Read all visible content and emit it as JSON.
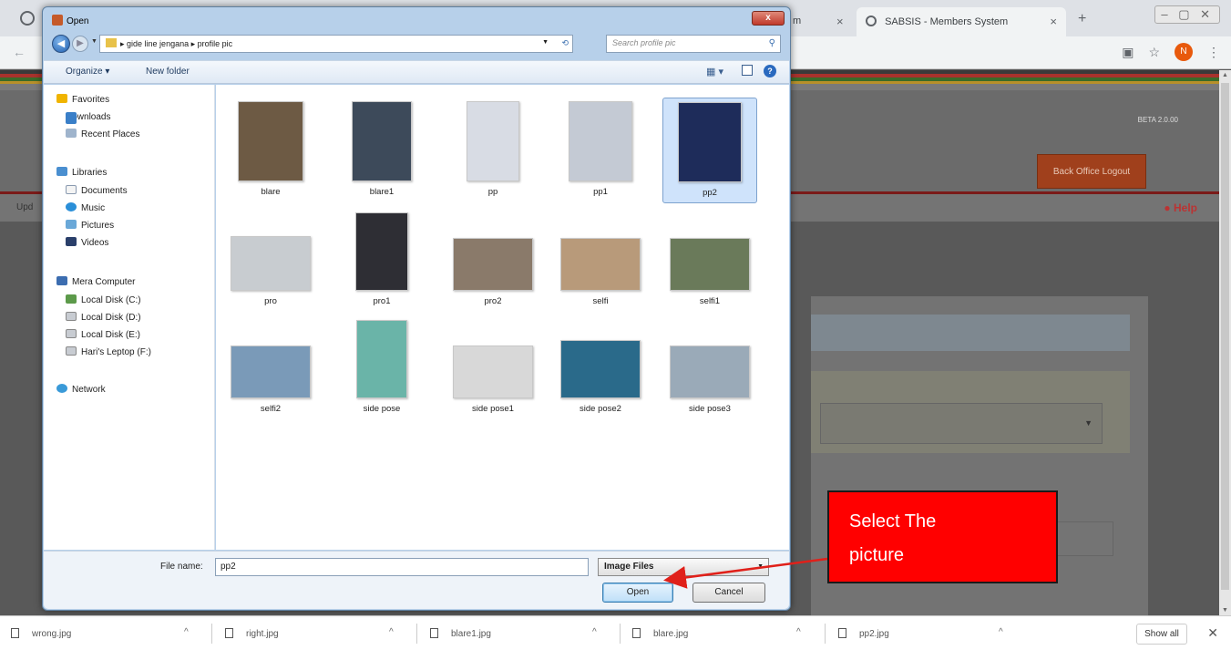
{
  "browser": {
    "tabs": [
      {
        "label": "m"
      },
      {
        "label": "SABSIS - Members System"
      }
    ],
    "profile_initial": "N",
    "version_text": "BETA 2.0.00",
    "back_office_label": "Back Office Logout",
    "nav_left_text": "Upd",
    "help_label": "Help"
  },
  "dialog": {
    "title": "Open",
    "close_label": "x",
    "breadcrumb": "gide line jengana ▸ profile pic",
    "search_placeholder": "Search profile pic",
    "organize_label": "Organize ▾",
    "new_folder_label": "New folder",
    "nav_pane": [
      {
        "label": "Favorites",
        "icon": "star"
      },
      {
        "label": "Downloads",
        "icon": "dl"
      },
      {
        "label": "Recent Places",
        "icon": "rp"
      },
      {
        "label": "Libraries",
        "icon": "lib"
      },
      {
        "label": "Documents",
        "icon": "doc"
      },
      {
        "label": "Music",
        "icon": "mus"
      },
      {
        "label": "Pictures",
        "icon": "pic"
      },
      {
        "label": "Videos",
        "icon": "vid"
      },
      {
        "label": "Mera Computer",
        "icon": "comp"
      },
      {
        "label": "Local Disk (C:)",
        "icon": "disk"
      },
      {
        "label": "Local Disk (D:)",
        "icon": "drv"
      },
      {
        "label": "Local Disk (E:)",
        "icon": "drv"
      },
      {
        "label": "Hari's Leptop (F:)",
        "icon": "drv"
      },
      {
        "label": "Network",
        "icon": "net"
      }
    ],
    "files": [
      {
        "name": "blare",
        "color": "#6d5a44"
      },
      {
        "name": "blare1",
        "color": "#3d4a5a"
      },
      {
        "name": "pp",
        "color": "#d8dce4"
      },
      {
        "name": "pp1",
        "color": "#c4cad4"
      },
      {
        "name": "pp2",
        "color": "#1e2c5a",
        "selected": true
      },
      {
        "name": "pro",
        "color": "#c8ccd0"
      },
      {
        "name": "pro1",
        "color": "#2e2e34"
      },
      {
        "name": "pro2",
        "color": "#8a7a6a"
      },
      {
        "name": "selfi",
        "color": "#b89a7a"
      },
      {
        "name": "selfi1",
        "color": "#6a7a5a"
      },
      {
        "name": "selfi2",
        "color": "#7a9ab8"
      },
      {
        "name": "side pose",
        "color": "#6ab4a8"
      },
      {
        "name": "side pose1",
        "color": "#d8d8d8"
      },
      {
        "name": "side pose2",
        "color": "#2a6a8a"
      },
      {
        "name": "side pose3",
        "color": "#9aaab8"
      }
    ],
    "file_name_label": "File name:",
    "file_name_value": "pp2",
    "filter_value": "Image Files",
    "open_label": "Open",
    "cancel_label": "Cancel"
  },
  "downloads": [
    {
      "name": "wrong.jpg"
    },
    {
      "name": "right.jpg"
    },
    {
      "name": "blare1.jpg"
    },
    {
      "name": "blare.jpg"
    },
    {
      "name": "pp2.jpg"
    }
  ],
  "show_all_label": "Show all",
  "annotation": {
    "line1": "Select The",
    "line2": "picture",
    "color": "#ff0000"
  }
}
